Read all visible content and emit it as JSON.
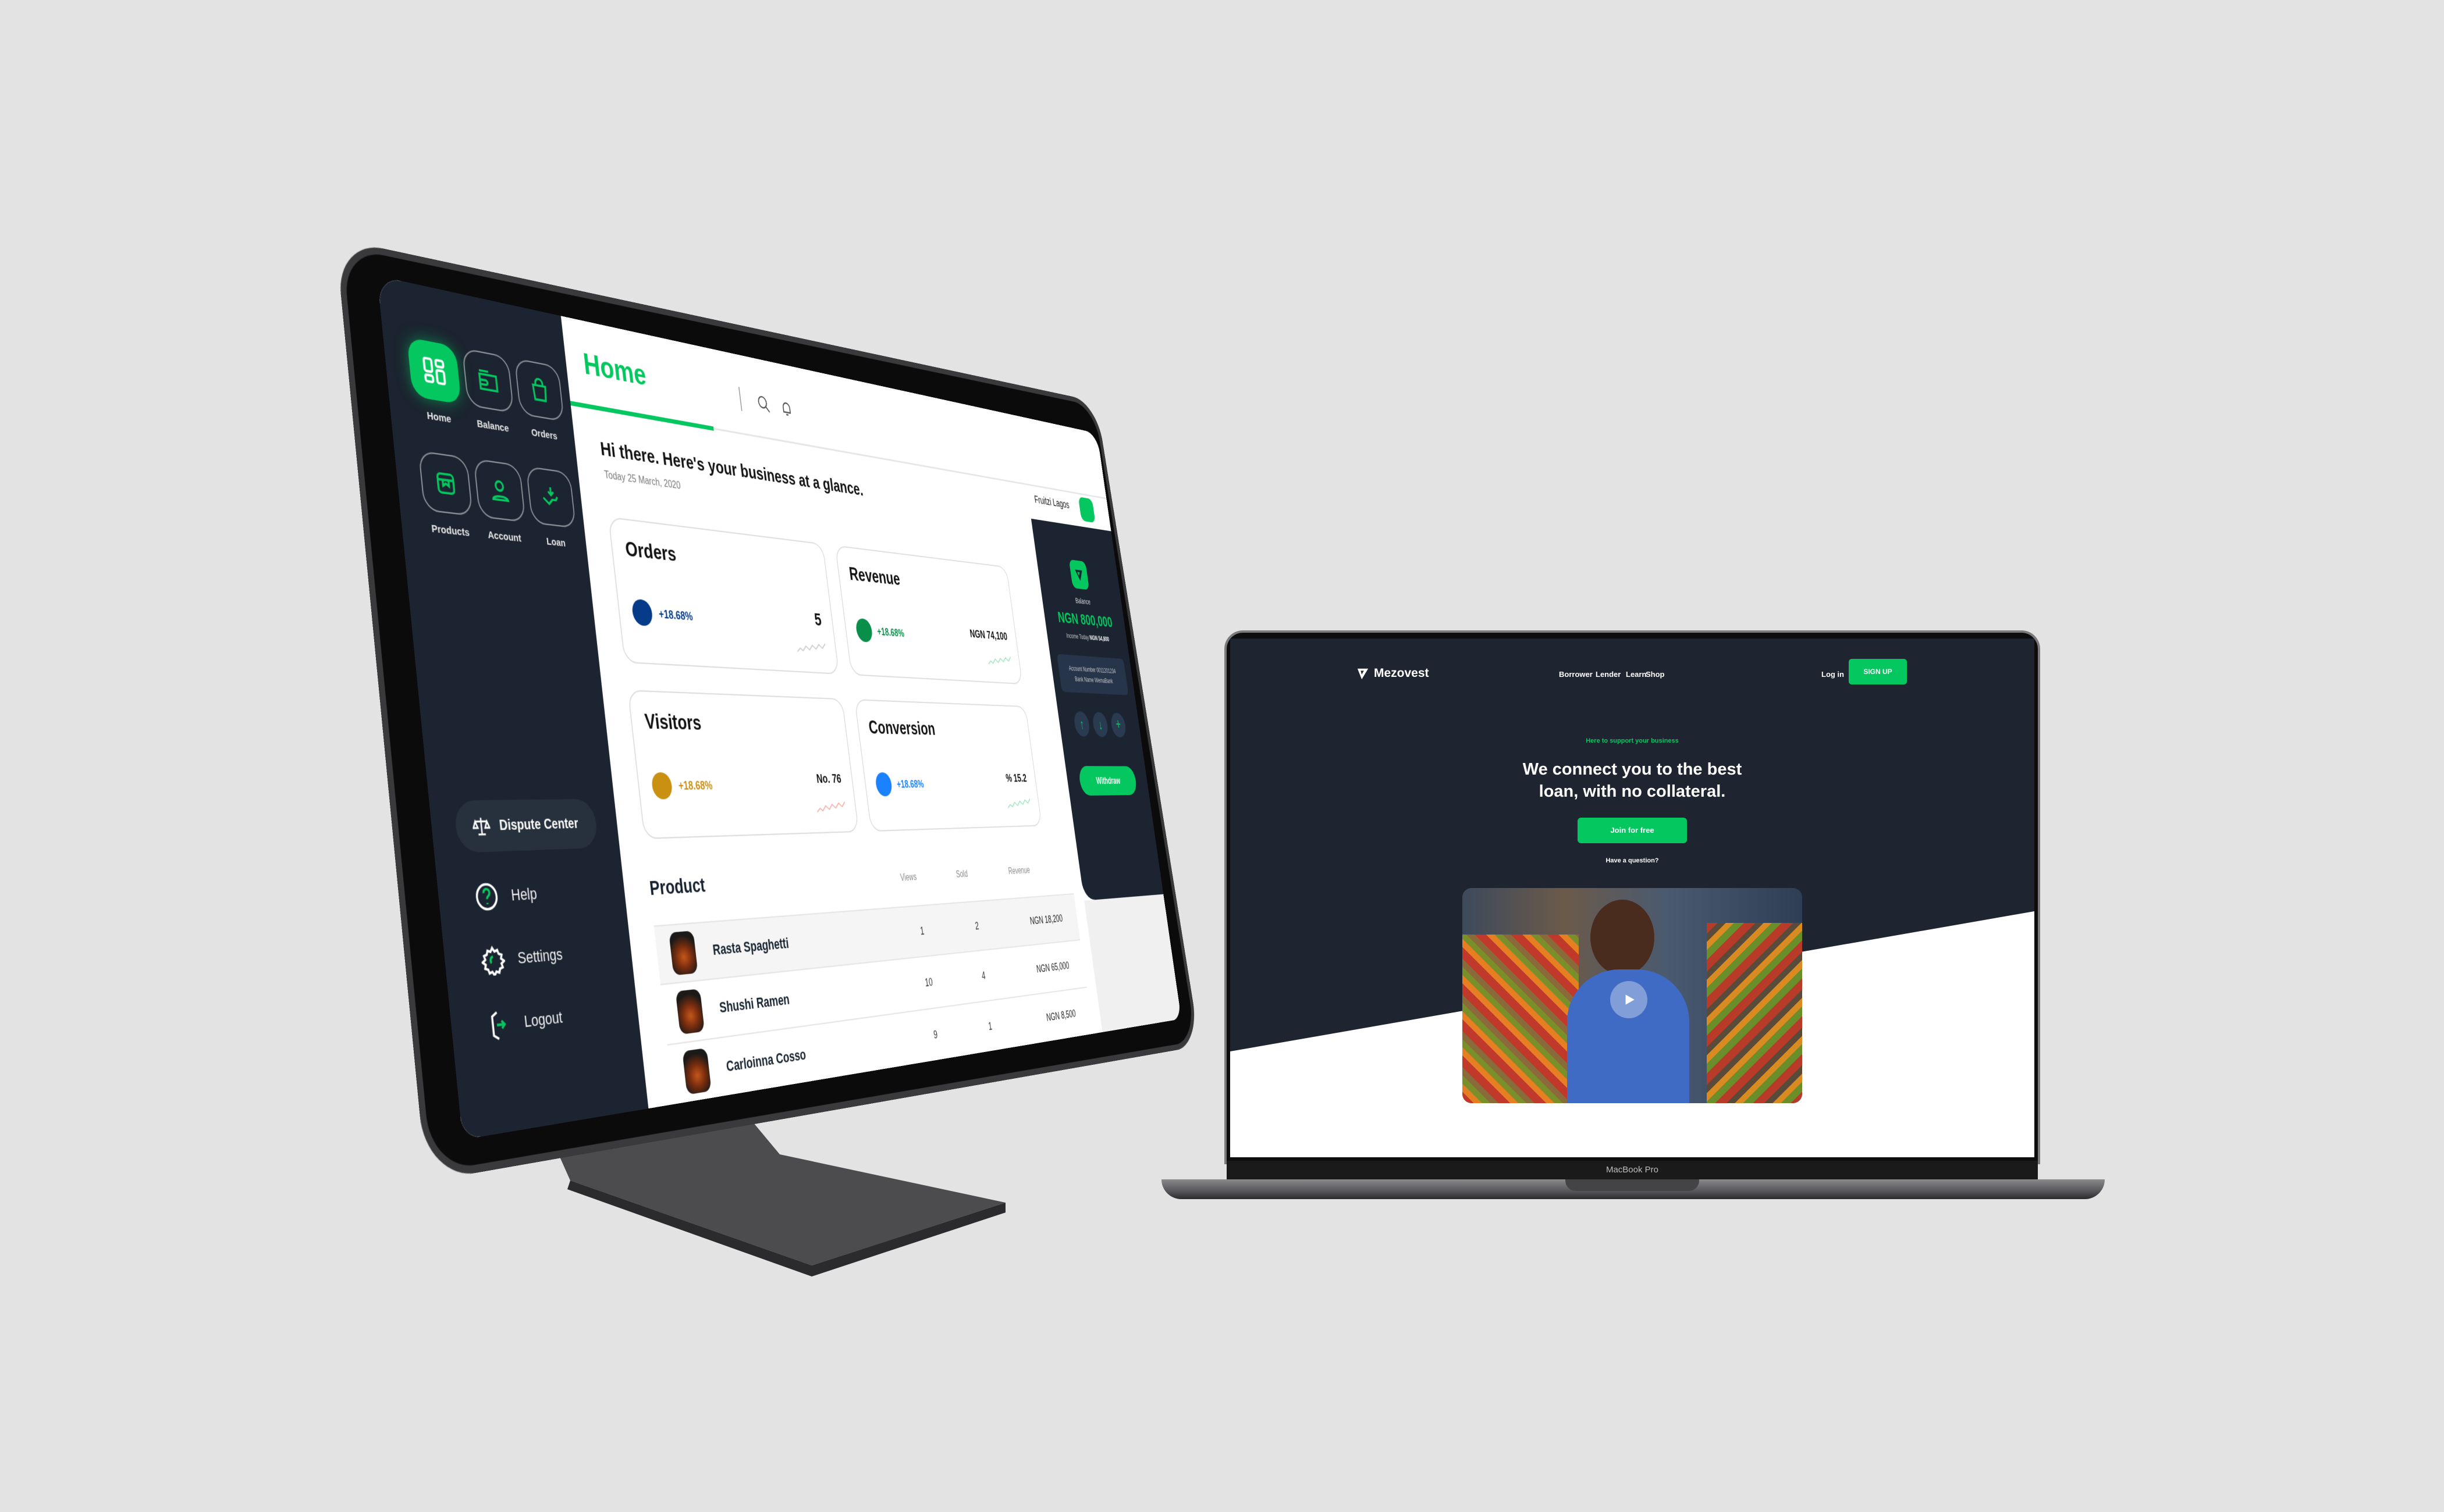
{
  "dashboard": {
    "page_title": "Home",
    "sidebar": {
      "items": [
        {
          "label": "Home",
          "icon": "grid-icon",
          "active": true
        },
        {
          "label": "Balance",
          "icon": "wallet-icon"
        },
        {
          "label": "Orders",
          "icon": "shopping-bag-icon"
        },
        {
          "label": "Products",
          "icon": "box-icon"
        },
        {
          "label": "Account",
          "icon": "user-icon"
        },
        {
          "label": "Loan",
          "icon": "hand-receive-icon"
        }
      ],
      "dispute_center": "Dispute Center",
      "help": "Help",
      "settings": "Settings",
      "logout": "Logout"
    },
    "user_name": "Fruitzi Lagos",
    "greeting": "Hi there. Here's your business at a glance.",
    "date": "Today 25 March, 2020",
    "cards": [
      {
        "title": "Orders",
        "change": "+18.68%",
        "value": "5",
        "color": "#063b8a"
      },
      {
        "title": "Revenue",
        "change": "+18.68%",
        "value": "NGN 74,100",
        "color": "#0a8f4a"
      },
      {
        "title": "Visitors",
        "change": "+18.68%",
        "value": "No. 76",
        "color": "#c99012"
      },
      {
        "title": "Conversion",
        "change": "+18.68%",
        "value": "% 15.2",
        "color": "#1a82ff"
      }
    ],
    "products": {
      "title": "Product",
      "columns": [
        "Views",
        "Sold",
        "Revenue"
      ],
      "rows": [
        {
          "name": "Rasta Spaghetti",
          "views": "1",
          "sold": "2",
          "revenue": "NGN 18,200"
        },
        {
          "name": "Shushi Ramen",
          "views": "10",
          "sold": "4",
          "revenue": "NGN 65,000"
        },
        {
          "name": "Carloinna Cosso",
          "views": "9",
          "sold": "1",
          "revenue": "NGN 8,500"
        }
      ]
    },
    "balance": {
      "label": "Balance",
      "amount": "NGN 800,000",
      "income_label": "Income Today",
      "income_value": "NGN 54,800",
      "account_number": "Account Number 0011201234",
      "bank_name": "Bank Name WemaBank",
      "withdraw": "Withdraw"
    },
    "accent": "#05c75f",
    "sidebar_bg": "#1b2430"
  },
  "landing": {
    "brand": "Mezovest",
    "nav": [
      "Borrower",
      "Lender",
      "Learn",
      "Shop"
    ],
    "login": "Log in",
    "signup": "SIGN UP",
    "eyebrow": "Here to support your business",
    "headline_1": "We connect you to the best",
    "headline_2": "loan, with no collateral.",
    "cta": "Join for free",
    "question": "Have a question?",
    "bg": "#1f2530"
  },
  "device_label": "MacBook Pro"
}
